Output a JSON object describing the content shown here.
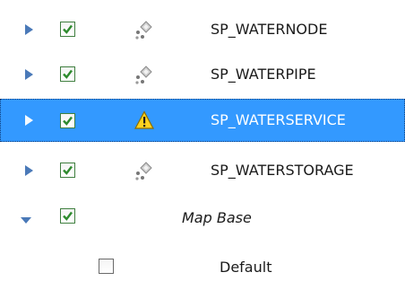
{
  "tree": {
    "rows": [
      {
        "label": "SP_WATERNODE",
        "expanded": false,
        "checked": true,
        "selected": false,
        "icon": "layer-node-icon"
      },
      {
        "label": "SP_WATERPIPE",
        "expanded": false,
        "checked": true,
        "selected": false,
        "icon": "layer-node-icon"
      },
      {
        "label": "SP_WATERSERVICE",
        "expanded": false,
        "checked": true,
        "selected": true,
        "icon": "warning-icon"
      },
      {
        "label": "SP_WATERSTORAGE",
        "expanded": false,
        "checked": true,
        "selected": false,
        "icon": "layer-node-icon"
      },
      {
        "label": "Map Base",
        "expanded": true,
        "checked": true,
        "selected": false,
        "icon": ""
      },
      {
        "label": "Default",
        "expanded": false,
        "checked": false,
        "selected": false,
        "icon": ""
      }
    ]
  },
  "colors": {
    "selection": "#3399ff",
    "expander": "#4a79b8",
    "checkmark": "#2e8b2e",
    "warning": "#ffd21f"
  }
}
